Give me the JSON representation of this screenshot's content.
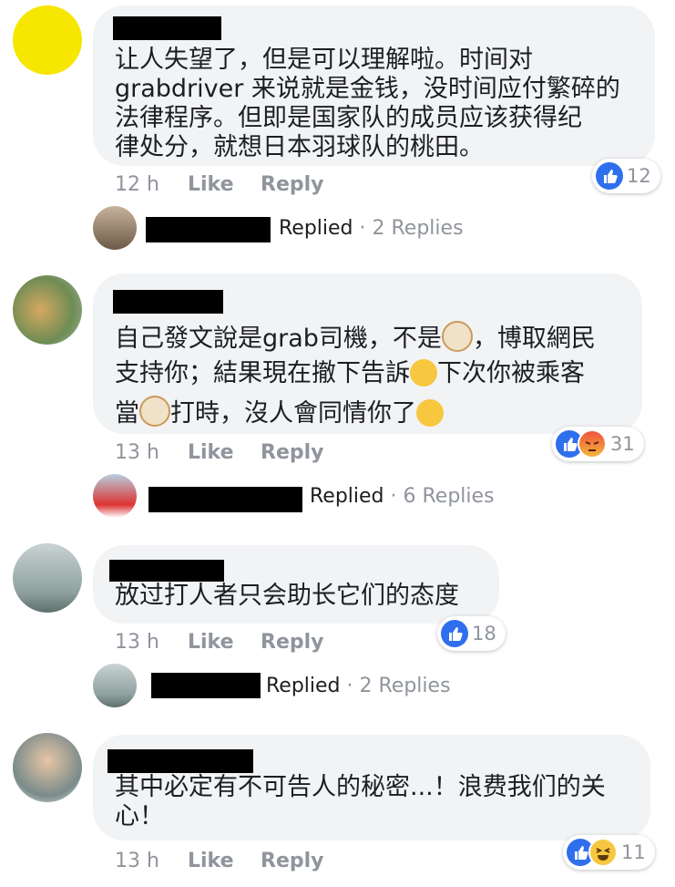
{
  "comments": [
    {
      "lines": [
        "让人失望了，但是可以理解啦。时间对",
        "grabdriver 来说就是金钱，没时间应付繁碎的",
        "法律程序。但即是国家队的成员应该获得纪",
        "律处分，就想日本羽球队的桃田。"
      ],
      "time": "12 h",
      "like": "Like",
      "reply": "Reply",
      "reaction_count": "12",
      "replied_label": "Replied",
      "replies_count": "· 2 Replies",
      "avatar_color": "#f7e600"
    },
    {
      "line1_a": "自己發文說是grab司機，不是",
      "line1_b": "，博取網民",
      "line2_a": "支持你；結果現在撤下告訴",
      "line2_b": "下次你被乘客",
      "line3_a": "當",
      "line3_b": "打時，沒人會同情你了",
      "time": "13 h",
      "like": "Like",
      "reply": "Reply",
      "reaction_count": "31",
      "replied_label": "Replied",
      "replies_count": "· 6 Replies"
    },
    {
      "lines": [
        "放过打人者只会助长它们的态度"
      ],
      "time": "13 h",
      "like": "Like",
      "reply": "Reply",
      "reaction_count": "18",
      "replied_label": "Replied",
      "replies_count": "· 2 Replies"
    },
    {
      "lines": [
        "其中必定有不可告人的秘密...！浪费我们的关",
        "心！"
      ],
      "time": "13 h",
      "like": "Like",
      "reply": "Reply",
      "reaction_count": "11"
    }
  ]
}
